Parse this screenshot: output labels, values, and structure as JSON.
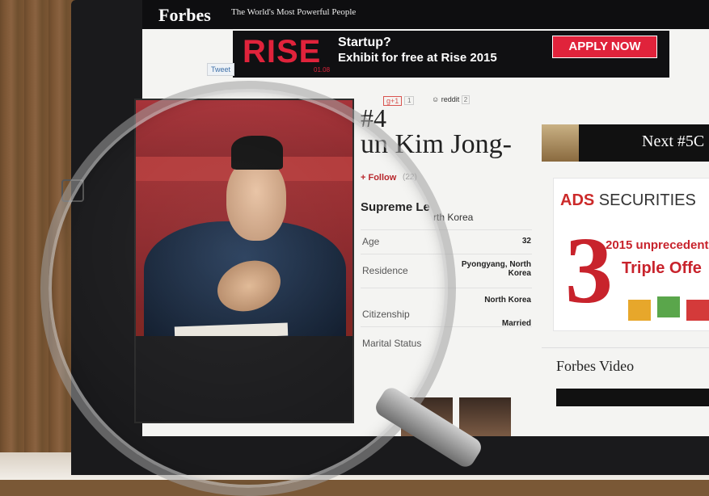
{
  "header": {
    "logo": "Forbes",
    "tagline": "The World's Most Powerful People"
  },
  "banner": {
    "brand": "RISE",
    "date": "01.08",
    "headline": "Startup?",
    "subline": "Exhibit for free at Rise 2015",
    "cta": "APPLY NOW",
    "accent_color": "#e0233b"
  },
  "social": {
    "tweet_label": "Tweet",
    "gplus_label": "g+1",
    "gplus_count": "1",
    "reddit_label": "reddit",
    "reddit_count": "2"
  },
  "profile": {
    "rank": "#4",
    "name": "un Kim Jong-",
    "follow_label": "+ Follow",
    "follow_count": "(22)",
    "title": "Supreme Le",
    "title_rest": "rth Korea",
    "rows": [
      {
        "label": "Age",
        "value": "32"
      },
      {
        "label": "Residence",
        "value": "Pyongyang, North Korea"
      },
      {
        "label": "Citizenship",
        "value": "North Korea"
      },
      {
        "label": "Marital Status",
        "value": "Married"
      }
    ]
  },
  "sidebar": {
    "next_label": "Next #5C",
    "ad": {
      "brand_prefix": "ADS",
      "brand_suffix": " SECURITIES",
      "big_number": "3",
      "line1": "2015 unprecedent",
      "line2": "Triple Offe"
    },
    "video_title": "Forbes Video"
  }
}
